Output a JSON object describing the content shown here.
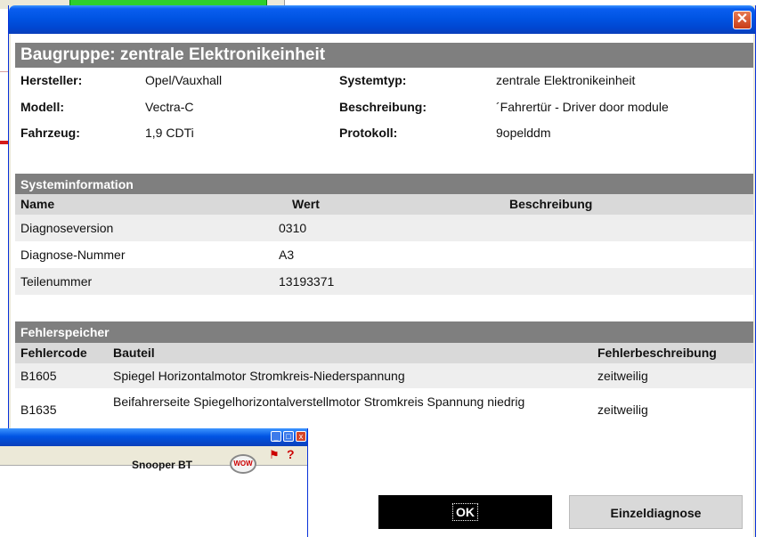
{
  "dialog": {
    "close_label": "✕",
    "main_header": "Baugruppe: zentrale Elektronikeinheit",
    "info": {
      "hersteller_label": "Hersteller:",
      "hersteller_value": "Opel/Vauxhall",
      "modell_label": "Modell:",
      "modell_value": "Vectra-C",
      "fahrzeug_label": "Fahrzeug:",
      "fahrzeug_value": "1,9 CDTi",
      "systemtyp_label": "Systemtyp:",
      "systemtyp_value": "zentrale Elektronikeinheit",
      "beschreibung_label": "Beschreibung:",
      "beschreibung_value": "´Fahrertür - Driver door module",
      "protokoll_label": "Protokoll:",
      "protokoll_value": "9opelddm"
    },
    "systeminfo": {
      "header": "Systeminformation",
      "columns": [
        "Name",
        "Wert",
        "Beschreibung"
      ],
      "rows": [
        {
          "name": "Diagnoseversion",
          "wert": "0310",
          "beschreibung": ""
        },
        {
          "name": "Diagnose-Nummer",
          "wert": "A3",
          "beschreibung": ""
        },
        {
          "name": "Teilenummer",
          "wert": "13193371",
          "beschreibung": ""
        }
      ]
    },
    "fehlerspeicher": {
      "header": "Fehlerspeicher",
      "columns": [
        "Fehlercode",
        "Bauteil",
        "Fehlerbeschreibung"
      ],
      "rows": [
        {
          "code": "B1605",
          "bauteil": "Spiegel Horizontalmotor Stromkreis-Niederspannung",
          "beschreibung": "zeitweilig"
        },
        {
          "code": "B1635",
          "bauteil": "Beifahrerseite Spiegelhorizontalverstellmotor Stromkreis Spannung niedrig",
          "beschreibung": "zeitweilig"
        }
      ]
    },
    "buttons": {
      "ok": "OK",
      "einzeldiagnose": "Einzeldiagnose"
    }
  },
  "snooper": {
    "title": "Snooper BT",
    "logo_text": "WOW",
    "help_label": "?"
  },
  "colors": {
    "titlebar_blue": "#0054e3",
    "section_gray": "#7f7f7f",
    "column_header_gray": "#d9d9d9",
    "ok_button_bg": "#000000"
  }
}
